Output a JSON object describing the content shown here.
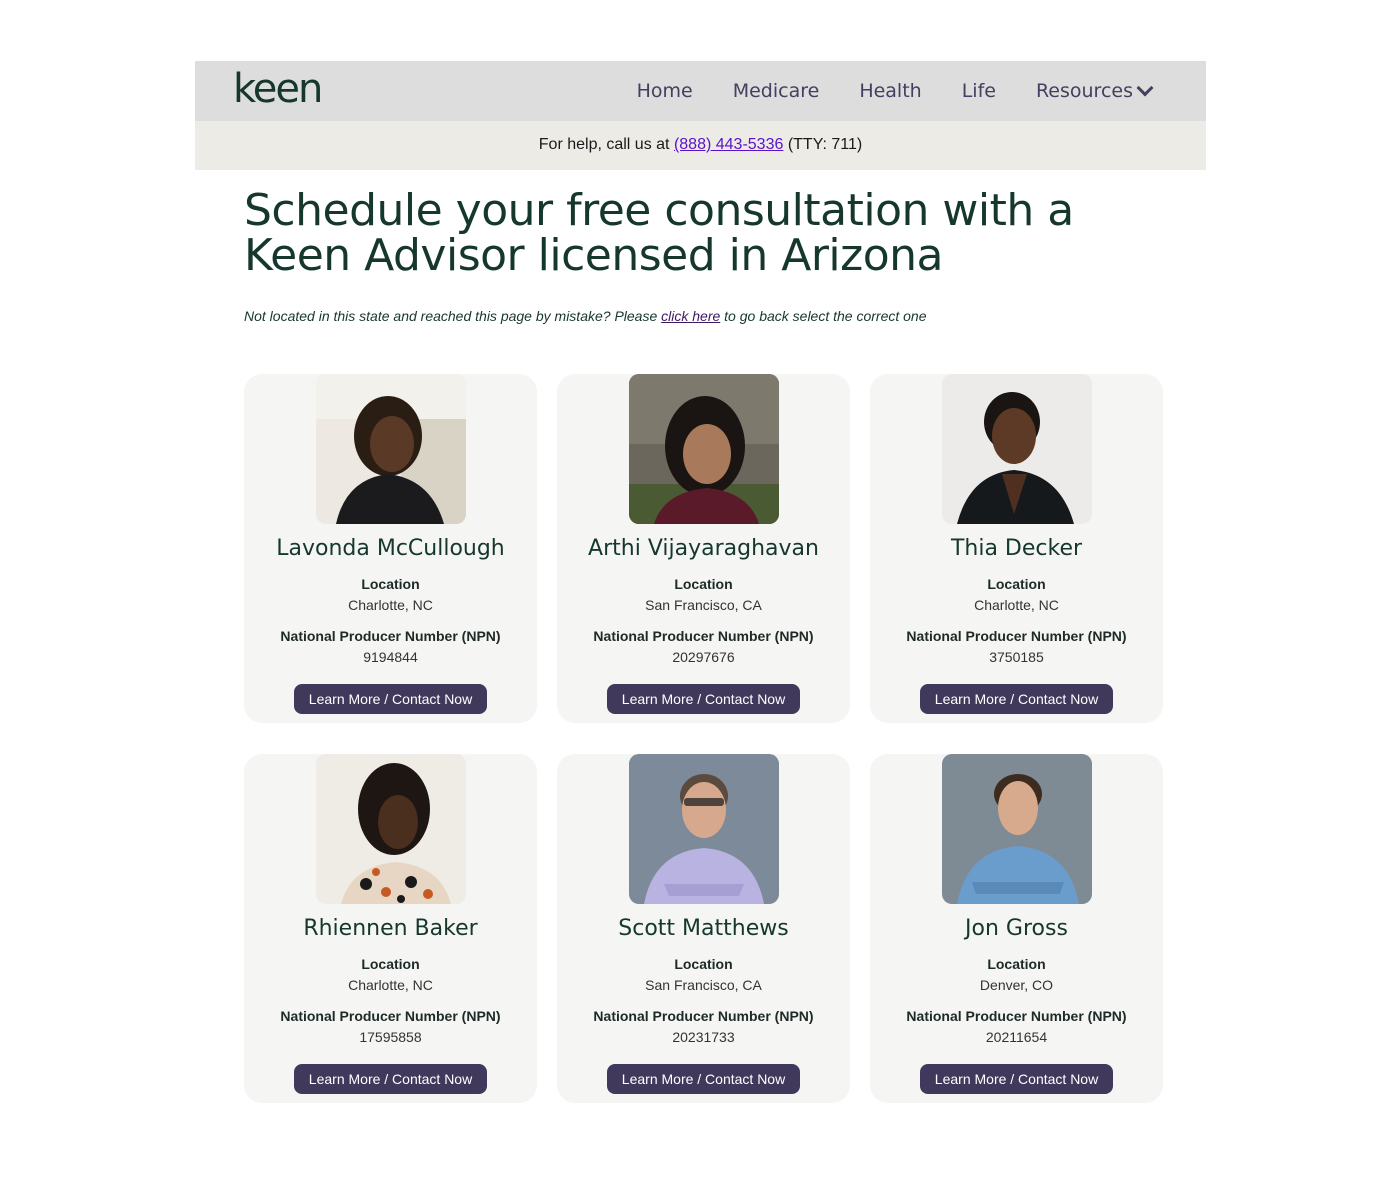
{
  "header": {
    "logo": "keen",
    "nav": [
      {
        "label": "Home"
      },
      {
        "label": "Medicare"
      },
      {
        "label": "Health"
      },
      {
        "label": "Life"
      },
      {
        "label": "Resources"
      }
    ]
  },
  "help": {
    "prefix": "For help, call us at",
    "phone": "(888) 443-5336",
    "suffix": "(TTY: 711)"
  },
  "page": {
    "title": "Schedule your free consultation with a Keen Advisor licensed in Arizona",
    "notice_prefix": "Not located in this state and reached this page by mistake? Please",
    "notice_link": "click here",
    "notice_suffix": "to go back select the correct one"
  },
  "labels": {
    "location": "Location",
    "npn": "National Producer Number (NPN)",
    "button": "Learn More / Contact Now"
  },
  "advisors": [
    {
      "name": "Lavonda McCullough",
      "location": "Charlotte, NC",
      "npn": "9194844"
    },
    {
      "name": "Arthi Vijayaraghavan",
      "location": "San Francisco, CA",
      "npn": "20297676"
    },
    {
      "name": "Thia Decker",
      "location": "Charlotte, NC",
      "npn": "3750185"
    },
    {
      "name": "Rhiennen Baker",
      "location": "Charlotte, NC",
      "npn": "17595858"
    },
    {
      "name": "Scott Matthews",
      "location": "San Francisco, CA",
      "npn": "20231733"
    },
    {
      "name": "Jon Gross",
      "location": "Denver, CO",
      "npn": "20211654"
    }
  ],
  "colors": {
    "brand_dark": "#16372e",
    "nav_bg": "#dddddd",
    "help_bg": "#ecebe6",
    "button_bg": "#40395c",
    "card_bg": "#f5f5f4",
    "link": "#5b13c8"
  }
}
